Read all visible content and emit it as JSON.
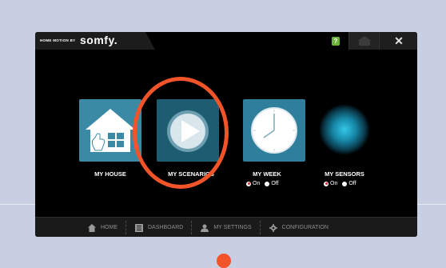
{
  "brand": {
    "prefix": "HOME MOTION BY",
    "logo": "somfy."
  },
  "topbar": {
    "help_label": "?",
    "home_icon": "home-icon",
    "close_label": "✕"
  },
  "tiles": [
    {
      "label": "MY HOUSE",
      "icon": "house-with-hand-icon"
    },
    {
      "label": "MY SCENARIOS",
      "icon": "play-icon"
    },
    {
      "label": "MY WEEK",
      "icon": "clock-icon"
    },
    {
      "label": "MY SENSORS",
      "icon": "sensor-glow-icon"
    }
  ],
  "toggles": {
    "week": {
      "on": "On",
      "off": "Off",
      "selected": "On"
    },
    "sensors": {
      "on": "On",
      "off": "Off",
      "selected": "On"
    }
  },
  "bottom_nav": [
    {
      "label": "HOME",
      "icon": "home-icon"
    },
    {
      "label": "DASHBOARD",
      "icon": "dashboard-icon"
    },
    {
      "label": "MY SETTINGS",
      "icon": "user-icon"
    },
    {
      "label": "CONFIGURATION",
      "icon": "gear-icon"
    }
  ],
  "colors": {
    "accent_highlight": "#f2542a",
    "tile_blue": "#3a8aa6",
    "help_green": "#6cb33e",
    "radio_on": "#d8262b"
  }
}
